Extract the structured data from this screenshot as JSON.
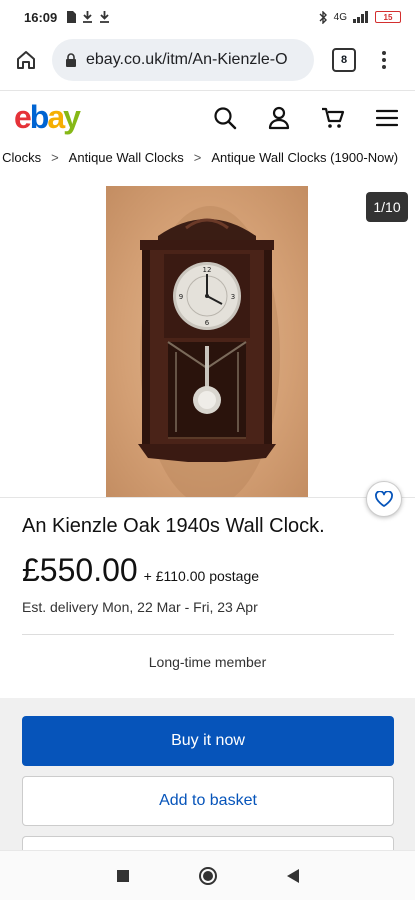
{
  "status_bar": {
    "time": "16:09",
    "network": "4G",
    "battery": "15"
  },
  "browser": {
    "url": "ebay.co.uk/itm/An-Kienzle-O",
    "tab_count": "8"
  },
  "header": {
    "logo": {
      "e": "e",
      "b": "b",
      "a": "a",
      "y": "y"
    }
  },
  "breadcrumb": {
    "items": [
      "ue Clocks",
      "Antique Wall Clocks",
      "Antique Wall Clocks (1900-Now)"
    ],
    "separator": ">"
  },
  "gallery": {
    "counter": "1/10"
  },
  "product": {
    "title": "An Kienzle Oak 1940s Wall Clock.",
    "price": "£550.00",
    "postage": "+ £110.00 postage",
    "delivery": "Est. delivery Mon, 22 Mar - Fri, 23 Apr",
    "seller_badge": "Long-time member"
  },
  "actions": {
    "buy_now": "Buy it now",
    "add_to_basket": "Add to basket"
  },
  "colors": {
    "buy_button": "#0654ba",
    "ebay_red": "#e53238",
    "ebay_blue": "#0064d2",
    "ebay_yellow": "#f5af02",
    "ebay_green": "#86b817"
  }
}
